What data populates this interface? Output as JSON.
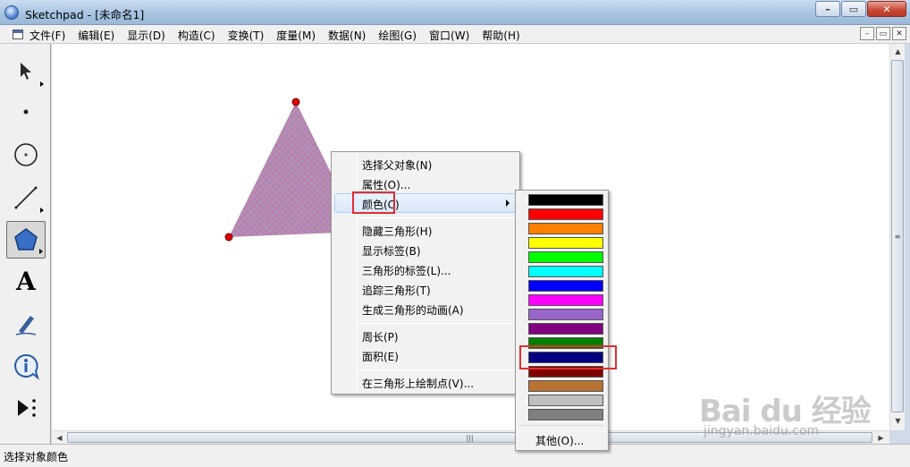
{
  "window": {
    "title": "Sketchpad - [未命名1]",
    "buttons": [
      "–",
      "▭",
      "✕"
    ]
  },
  "menubar": {
    "items": [
      "文件(F)",
      "编辑(E)",
      "显示(D)",
      "构造(C)",
      "变换(T)",
      "度量(M)",
      "数据(N)",
      "绘图(G)",
      "窗口(W)",
      "帮助(H)"
    ],
    "mdi_buttons": [
      "–",
      "▭",
      "✕"
    ]
  },
  "toolbox": {
    "tools": [
      {
        "name": "arrow-tool-icon",
        "selected": false
      },
      {
        "name": "point-tool-icon",
        "selected": false
      },
      {
        "name": "compass-tool-icon",
        "selected": false
      },
      {
        "name": "straightedge-tool-icon",
        "selected": false
      },
      {
        "name": "polygon-tool-icon",
        "selected": true
      },
      {
        "name": "text-tool-icon",
        "selected": false
      },
      {
        "name": "marker-tool-icon",
        "selected": false
      },
      {
        "name": "information-tool-icon",
        "selected": false
      },
      {
        "name": "custom-tool-icon",
        "selected": false
      }
    ],
    "text_tool_glyph": "A"
  },
  "canvas": {
    "triangle_fill": "#c27bb7",
    "triangle_hatch": "#7cc49a",
    "vertex_color": "#e00000"
  },
  "context_menu": {
    "items": {
      "select_parents": "选择父对象(N)",
      "properties": "属性(O)...",
      "color": "颜色(C)",
      "hide_triangle": "隐藏三角形(H)",
      "show_label": "显示标签(B)",
      "triangle_label": "三角形的标签(L)...",
      "trace_triangle": "追踪三角形(T)",
      "animate_triangle": "生成三角形的动画(A)",
      "perimeter": "周长(P)",
      "area": "面积(E)",
      "plot_point": "在三角形上绘制点(V)..."
    }
  },
  "color_submenu": {
    "swatches": [
      "#000000",
      "#ff0000",
      "#ff8000",
      "#ffff00",
      "#00ff00",
      "#00ffff",
      "#0000ff",
      "#ff00ff",
      "#9966cc",
      "#800080",
      "#008000",
      "#000080",
      "#800000",
      "#b87333",
      "#c0c0c0",
      "#808080"
    ],
    "other": "其他(O)..."
  },
  "statusbar": {
    "text": "选择对象颜色"
  },
  "watermark": {
    "brand": "Bai du 经验",
    "url": "jingyan.baidu.com"
  }
}
